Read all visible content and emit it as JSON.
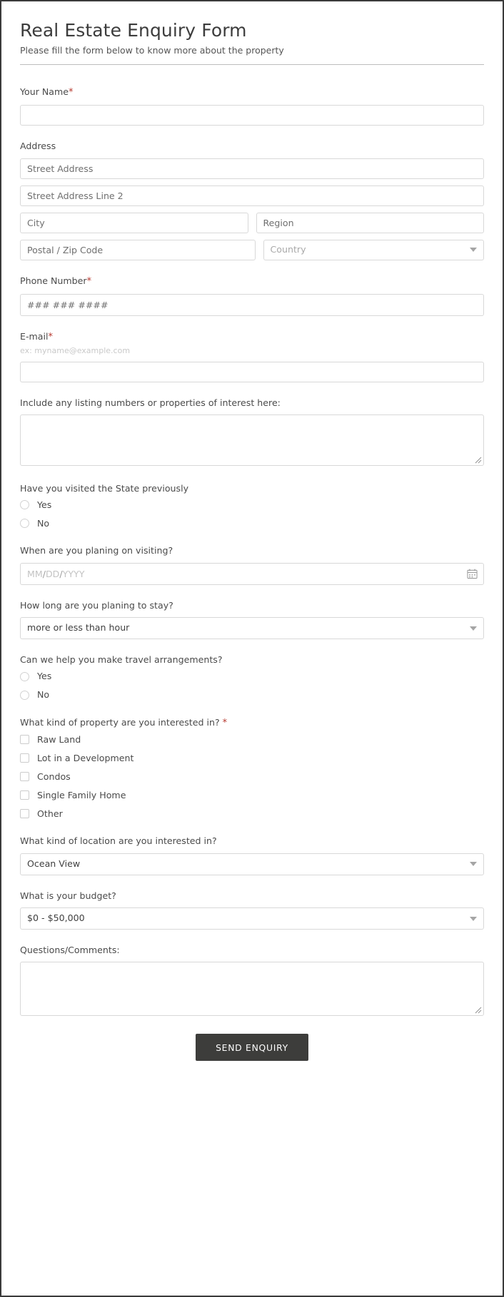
{
  "header": {
    "title": "Real Estate Enquiry Form",
    "subtitle": "Please fill the form below to know more about the property"
  },
  "fields": {
    "your_name": {
      "label": "Your Name",
      "required": true,
      "required_marker": "*",
      "value": "",
      "placeholder": ""
    },
    "address": {
      "label": "Address",
      "street1_placeholder": "Street Address",
      "street1_value": "",
      "street2_placeholder": "Street Address Line 2",
      "street2_value": "",
      "city_placeholder": "City",
      "city_value": "",
      "region_placeholder": "Region",
      "region_value": "",
      "postal_placeholder": "Postal / Zip Code",
      "postal_value": "",
      "country_placeholder": "Country",
      "country_value": ""
    },
    "phone": {
      "label": "Phone Number",
      "required_marker": "*",
      "placeholder": "### ### ####",
      "value": ""
    },
    "email": {
      "label": "E-mail",
      "required_marker": "*",
      "hint": "ex: myname@example.com",
      "value": "",
      "placeholder": ""
    },
    "listing_notes": {
      "label": "Include any listing numbers or properties of interest here:",
      "value": "",
      "placeholder": ""
    },
    "visited_state": {
      "label": "Have you visited the State previously",
      "options": [
        {
          "label": "Yes",
          "selected": false
        },
        {
          "label": "No",
          "selected": false
        }
      ]
    },
    "visit_date": {
      "label": "When are you planing on visiting?",
      "placeholder_parts": [
        "MM",
        "/",
        "DD",
        "/",
        "YYYY"
      ],
      "placeholder": "MM/DD/YYYY",
      "value": "",
      "icon": "calendar-icon"
    },
    "stay_length": {
      "label": "How long are you planing to stay?",
      "selected": "more or less than hour",
      "icon": "chevron-down-icon"
    },
    "travel_arrangements": {
      "label": "Can we help you make travel arrangements?",
      "options": [
        {
          "label": "Yes",
          "selected": false
        },
        {
          "label": "No",
          "selected": false
        }
      ]
    },
    "property_kind": {
      "label": "What kind of property are you interested in?",
      "required_marker": "*",
      "options": [
        {
          "label": "Raw Land",
          "checked": false
        },
        {
          "label": "Lot in a Development",
          "checked": false
        },
        {
          "label": "Condos",
          "checked": false
        },
        {
          "label": "Single Family Home",
          "checked": false
        },
        {
          "label": "Other",
          "checked": false
        }
      ]
    },
    "location_kind": {
      "label": "What kind of location are you interested in?",
      "selected": "Ocean View",
      "icon": "chevron-down-icon"
    },
    "budget": {
      "label": "What is your budget?",
      "selected": "$0 - $50,000",
      "icon": "chevron-down-icon"
    },
    "questions": {
      "label": "Questions/Comments:",
      "value": "",
      "placeholder": ""
    }
  },
  "submit": {
    "label": "SEND ENQUIRY"
  },
  "colors": {
    "required_star": "#b7392f",
    "submit_background": "#3d3d3b",
    "submit_text": "#ffffff",
    "border": "#d8d8d8",
    "label_text": "#4a4a4a",
    "title_text": "#3c3c3c",
    "frame_border": "#3a3a3a"
  }
}
